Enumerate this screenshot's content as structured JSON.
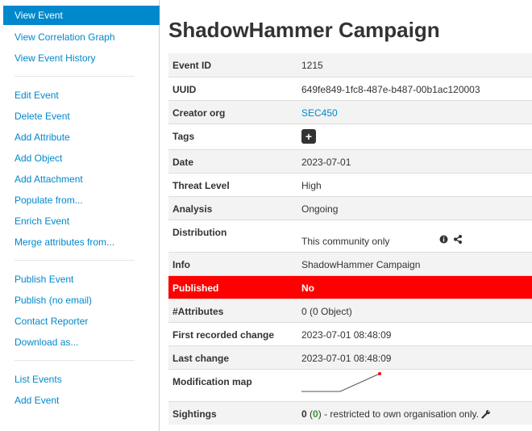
{
  "sidebar": {
    "active": "View Event",
    "group1": [
      "View Correlation Graph",
      "View Event History"
    ],
    "group2": [
      "Edit Event",
      "Delete Event",
      "Add Attribute",
      "Add Object",
      "Add Attachment",
      "Populate from...",
      "Enrich Event",
      "Merge attributes from..."
    ],
    "group3": [
      "Publish Event",
      "Publish (no email)",
      "Contact Reporter",
      "Download as..."
    ],
    "group4": [
      "List Events",
      "Add Event"
    ]
  },
  "event": {
    "title": "ShadowHammer Campaign",
    "rows": {
      "id": {
        "label": "Event ID",
        "value": "1215"
      },
      "uuid": {
        "label": "UUID",
        "value": "649fe849-1fc8-487e-b487-00b1ac120003"
      },
      "org": {
        "label": "Creator org",
        "value": "SEC450"
      },
      "tags": {
        "label": "Tags",
        "add_label": "+"
      },
      "date": {
        "label": "Date",
        "value": "2023-07-01"
      },
      "threat": {
        "label": "Threat Level",
        "value": "High"
      },
      "analysis": {
        "label": "Analysis",
        "value": "Ongoing"
      },
      "distribution": {
        "label": "Distribution",
        "value": "This community only"
      },
      "info": {
        "label": "Info",
        "value": "ShadowHammer Campaign"
      },
      "published": {
        "label": "Published",
        "value": "No"
      },
      "attributes": {
        "label": "#Attributes",
        "value": "0 (0 Object)"
      },
      "first_change": {
        "label": "First recorded change",
        "value": "2023-07-01 08:48:09"
      },
      "last_change": {
        "label": "Last change",
        "value": "2023-07-01 08:48:09"
      },
      "modmap": {
        "label": "Modification map"
      },
      "sightings": {
        "label": "Sightings",
        "count": "0",
        "count_green": "0",
        "text": "- restricted to own organisation only."
      }
    }
  },
  "colors": {
    "accent": "#0088cc",
    "published_bg": "#ff0000",
    "row_alt": "#f3f3f3"
  }
}
